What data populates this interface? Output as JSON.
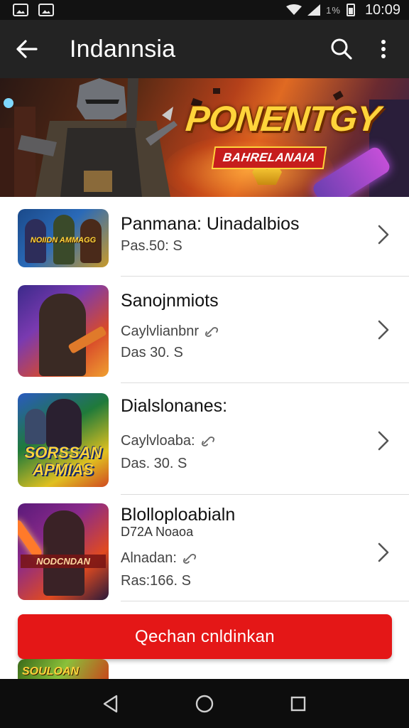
{
  "status_bar": {
    "time": "10:09",
    "signal_text": "1%",
    "left_icons": [
      "gallery-icon",
      "image-icon"
    ],
    "right_icons": [
      "wifi-icon",
      "signal-icon",
      "battery-icon"
    ]
  },
  "app_bar": {
    "title": "Indannsia",
    "back_icon": "arrow-left-icon",
    "search_icon": "search-icon",
    "more_icon": "more-vert-icon"
  },
  "banner": {
    "title": "PONENTGY",
    "subtitle": "BAHRELANAIA"
  },
  "games": [
    {
      "name": "Panmana: Uinadalbios",
      "subtitle": "",
      "meta": "Pas.50: S",
      "thumb_text": "NOIIDN AMMAGG",
      "colors": [
        "#1b4a8a",
        "#c99a2a",
        "#2d2d5a"
      ]
    },
    {
      "name": "Sanojnmiots",
      "subtitle": "Caylvlianbnr",
      "meta": "Das 30. S",
      "thumb_text": "",
      "colors": [
        "#3b2a8a",
        "#d84a2a",
        "#f0a030"
      ]
    },
    {
      "name": "Dialslonanes:",
      "subtitle": "Caylvloaba:",
      "meta": "Das. 30. S",
      "thumb_text": "SORSSAN APMIAS",
      "colors": [
        "#1f7a3a",
        "#e0c020",
        "#2a5ac0"
      ]
    },
    {
      "name": "Blolloploabialn",
      "secondary_name": "D72A Noaoa",
      "subtitle": "Alnadan:",
      "meta": "Ras:166. S",
      "thumb_text": "NODCNDAN",
      "colors": [
        "#5a1a7a",
        "#e04a20",
        "#2a1a3a"
      ]
    }
  ],
  "subtitle_icon": "link-icon",
  "row_icon": "chevron-right-icon",
  "cta": {
    "label": "Qechan cnldinkan"
  },
  "peek_thumb_text": "SOULOAN",
  "nav_bar": {
    "icons": [
      "back-triangle-icon",
      "home-circle-icon",
      "recents-square-icon"
    ]
  },
  "colors": {
    "accent": "#e41717",
    "app_bar": "#232323",
    "status_bar": "#121212",
    "nav_bar": "#0d0d0d"
  }
}
